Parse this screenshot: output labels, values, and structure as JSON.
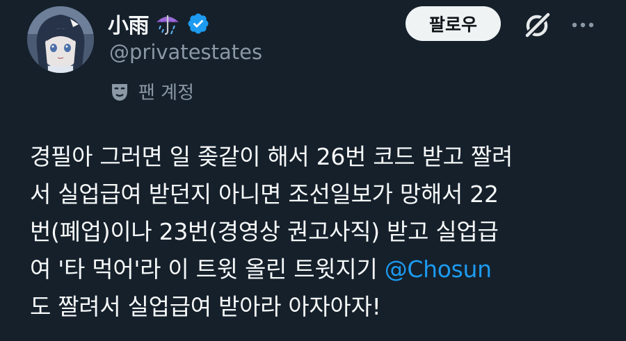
{
  "profile": {
    "display_name": "小雨",
    "display_emoji": "☔",
    "handle": "@privatestates",
    "verified": true,
    "account_label": "팬 계정",
    "account_label_icon": "mask-icon"
  },
  "actions": {
    "follow_label": "팔로우",
    "grok_icon": "grok-icon",
    "more_icon": "more-icon"
  },
  "tweet": {
    "line1": "경필아 그러면 일 좆같이 해서 26번 코드 받고 짤려",
    "line2": "서 실업급여 받던지 아니면 조선일보가 망해서 22",
    "line3": "번(폐업)이나 23번(경영상 권고사직) 받고 실업급",
    "line4_prefix": "여 '타 먹어'라 이 트윗 올린 트윗지기 ",
    "mention": "@Chosun",
    "line5": "도 짤려서 실업급여 받아라 아자아자!"
  },
  "colors": {
    "background": "#15202b",
    "text": "#f7f9f9",
    "muted": "#8b98a5",
    "accent": "#1d9bf0",
    "follow_bg": "#eff3f4"
  }
}
